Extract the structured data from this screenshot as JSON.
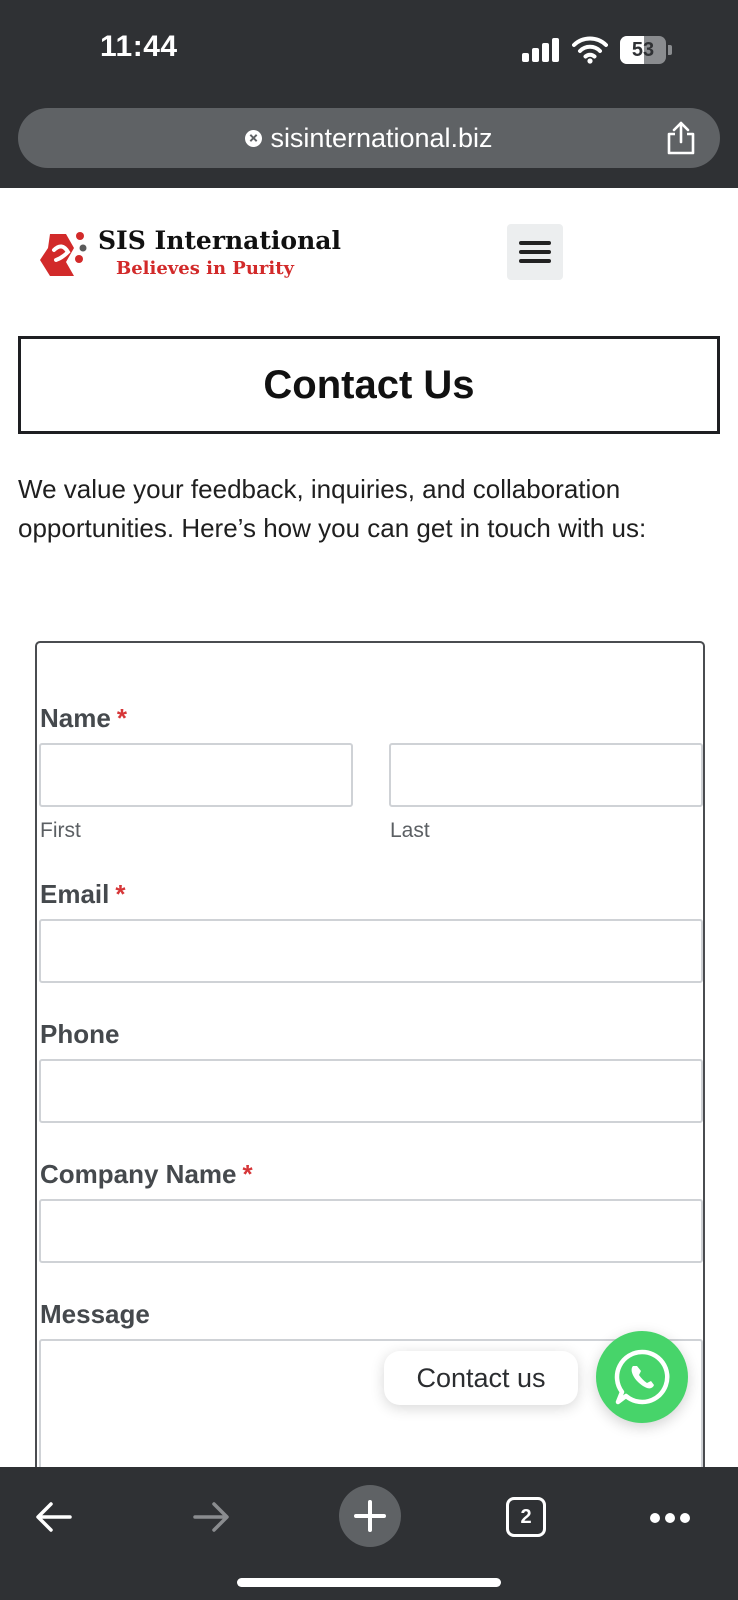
{
  "status_bar": {
    "time": "11:44",
    "battery_level": "53",
    "battery_fraction": 0.53
  },
  "browser": {
    "url": "sisinternational.biz",
    "open_tabs": "2",
    "icons": [
      "close-icon",
      "share-icon",
      "back-arrow-icon",
      "forward-arrow-icon",
      "plus-icon",
      "tabs-icon",
      "more-icon"
    ]
  },
  "site": {
    "brand": "SIS International",
    "tagline": "Believes in Purity",
    "logo_color": "#d22a2a"
  },
  "page": {
    "title": "Contact Us",
    "intro": "We value your feedback, inquiries, and collaboration opportunities. Here’s how you can get in touch with us:"
  },
  "form": {
    "name_label": "Name",
    "first_sub": "First",
    "last_sub": "Last",
    "email_label": "Email",
    "phone_label": "Phone",
    "company_label": "Company Name",
    "message_label": "Message",
    "required_mark": "*",
    "required_color": "#d63638"
  },
  "chat": {
    "label": "Contact us",
    "button_color": "#47d46a"
  }
}
